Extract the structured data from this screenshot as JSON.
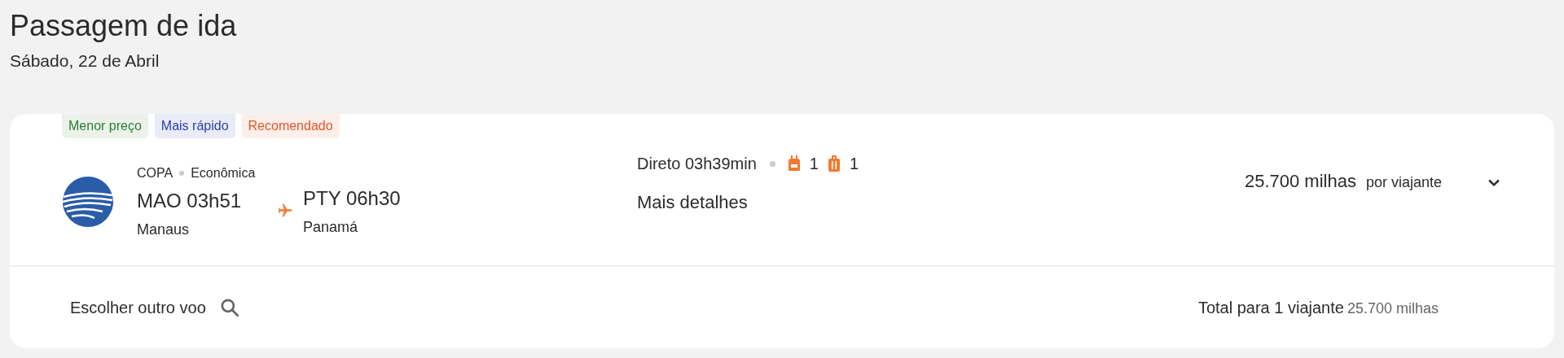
{
  "header": {
    "title": "Passagem de ida",
    "date": "Sábado, 22 de Abril"
  },
  "flight": {
    "tags": [
      {
        "label": "Menor preço",
        "color": "#2e7d32"
      },
      {
        "label": "Mais rápido",
        "color": "#2c3fa8"
      },
      {
        "label": "Recomendado",
        "color": "#e0582a"
      }
    ],
    "airline": "COPA",
    "cabin": "Econômica",
    "departure": {
      "code_time": "MAO 03h51",
      "city": "Manaus"
    },
    "arrival": {
      "code_time": "PTY 06h30",
      "city": "Panamá"
    },
    "stops": "Direto",
    "duration": "03h39min",
    "carry_on": "1",
    "checked_bag": "1",
    "details_link": "Mais detalhes",
    "price": "25.700 milhas",
    "price_unit": "por viajante",
    "expanded": false
  },
  "footer": {
    "other_flight": "Escolher outro voo",
    "total_label": "Total para 1 viajante",
    "total_value": "25.700 milhas"
  }
}
